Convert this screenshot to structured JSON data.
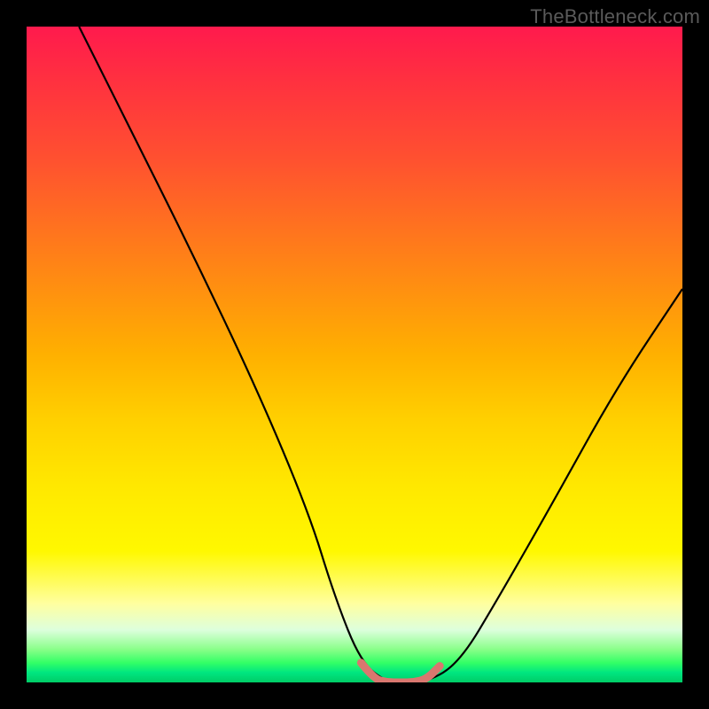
{
  "watermark": "TheBottleneck.com",
  "chart_data": {
    "type": "line",
    "title": "",
    "xlabel": "",
    "ylabel": "",
    "xlim": [
      0,
      100
    ],
    "ylim": [
      0,
      100
    ],
    "series": [
      {
        "name": "bottleneck-curve",
        "x": [
          8,
          15,
          25,
          35,
          43,
          47,
          51,
          55,
          57,
          61,
          66,
          72,
          80,
          90,
          100
        ],
        "y": [
          100,
          86,
          66,
          45,
          26,
          13,
          3,
          0,
          0,
          0,
          3,
          13,
          27,
          45,
          60
        ],
        "stroke": "#000000"
      },
      {
        "name": "highlight-band",
        "x": [
          51,
          53,
          55,
          57,
          59,
          61,
          63
        ],
        "y": [
          3,
          0.5,
          0,
          0,
          0,
          0.5,
          2.5
        ],
        "stroke": "#d9776f"
      }
    ],
    "gradient_stops": [
      {
        "pos": 0,
        "color": "#ff1a4d"
      },
      {
        "pos": 50,
        "color": "#ffd000"
      },
      {
        "pos": 88,
        "color": "#ffffa0"
      },
      {
        "pos": 100,
        "color": "#00cc66"
      }
    ]
  }
}
